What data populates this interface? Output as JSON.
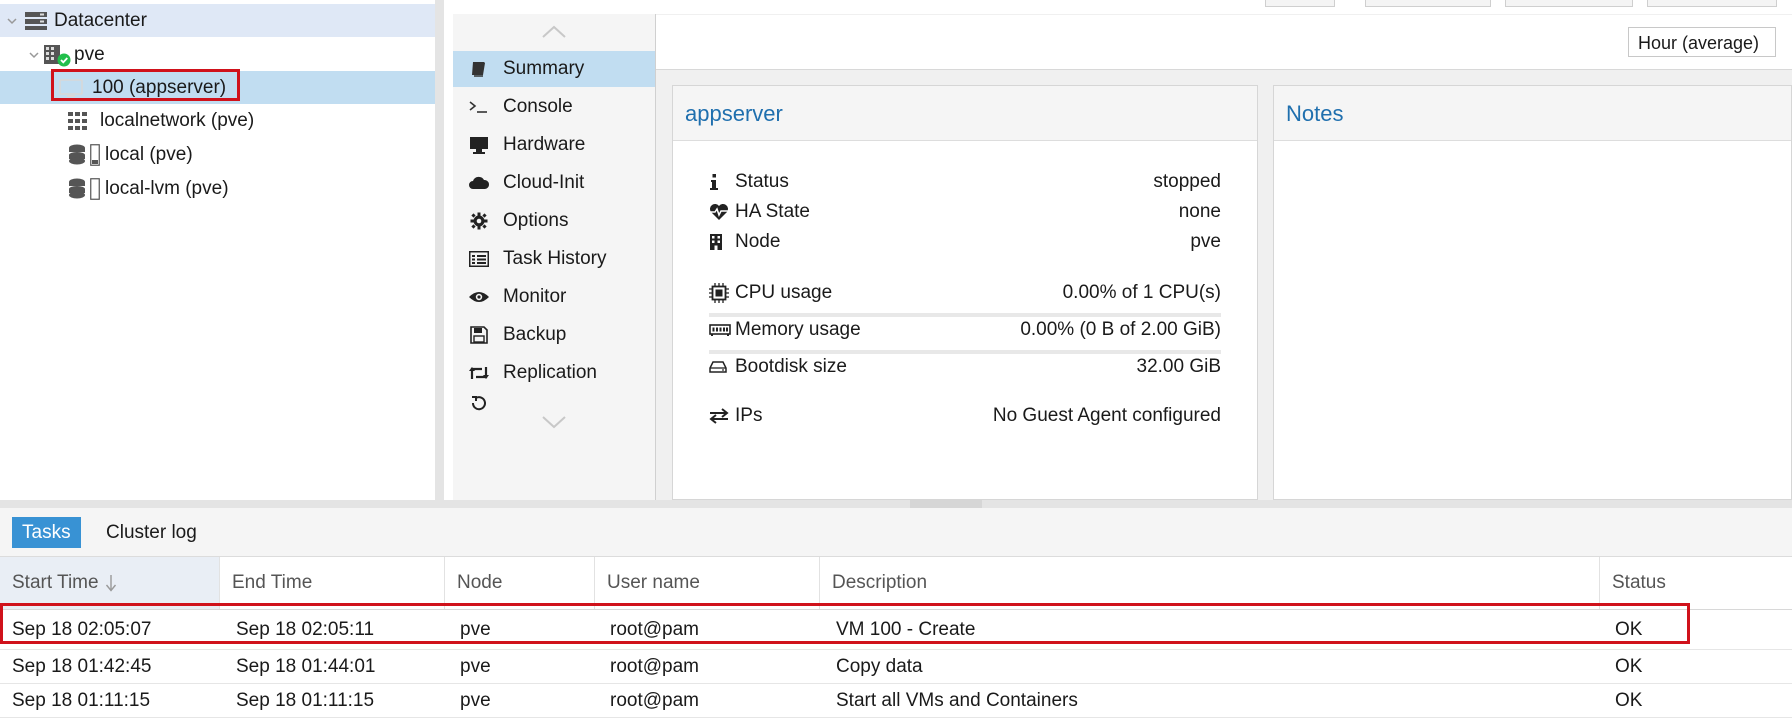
{
  "tree": {
    "datacenter": "Datacenter",
    "node": "pve",
    "vm": "100 (appserver)",
    "network": "localnetwork (pve)",
    "storage_local": "local (pve)",
    "storage_lvm": "local-lvm (pve)"
  },
  "menu": {
    "items": [
      {
        "label": "Summary",
        "icon": "book-icon"
      },
      {
        "label": "Console",
        "icon": "terminal-icon"
      },
      {
        "label": "Hardware",
        "icon": "desktop-icon"
      },
      {
        "label": "Cloud-Init",
        "icon": "cloud-icon"
      },
      {
        "label": "Options",
        "icon": "gear-icon"
      },
      {
        "label": "Task History",
        "icon": "list-icon"
      },
      {
        "label": "Monitor",
        "icon": "eye-icon"
      },
      {
        "label": "Backup",
        "icon": "floppy-icon"
      },
      {
        "label": "Replication",
        "icon": "retweet-icon"
      }
    ],
    "active": "Summary"
  },
  "toolbar": {
    "timeframe": "Hour (average)"
  },
  "summary": {
    "title": "appserver",
    "status_label": "Status",
    "status_value": "stopped",
    "ha_label": "HA State",
    "ha_value": "none",
    "node_label": "Node",
    "node_value": "pve",
    "cpu_label": "CPU usage",
    "cpu_value": "0.00% of 1 CPU(s)",
    "cpu_fraction": 0.0,
    "mem_label": "Memory usage",
    "mem_value": "0.00% (0 B of 2.00 GiB)",
    "mem_fraction": 0.0,
    "disk_label": "Bootdisk size",
    "disk_value": "32.00 GiB",
    "ips_label": "IPs",
    "ips_value": "No Guest Agent configured"
  },
  "notes": {
    "title": "Notes"
  },
  "log": {
    "tabs": [
      "Tasks",
      "Cluster log"
    ],
    "active_tab": "Tasks",
    "columns": [
      "Start Time",
      "End Time",
      "Node",
      "User name",
      "Description",
      "Status"
    ],
    "sort_column": "Start Time",
    "sort_direction": "descending",
    "rows": [
      {
        "start": "Sep 18 02:05:07",
        "end": "Sep 18 02:05:11",
        "node": "pve",
        "user": "root@pam",
        "desc": "VM 100 - Create",
        "status": "OK"
      },
      {
        "start": "Sep 18 01:42:45",
        "end": "Sep 18 01:44:01",
        "node": "pve",
        "user": "root@pam",
        "desc": "Copy data",
        "status": "OK"
      },
      {
        "start": "Sep 18 01:11:15",
        "end": "Sep 18 01:11:15",
        "node": "pve",
        "user": "root@pam",
        "desc": "Start all VMs and Containers",
        "status": "OK"
      }
    ]
  },
  "colors": {
    "accent": "#3892d4",
    "selection": "#c1ddf1",
    "highlight_box": "#d0121b",
    "title_blue": "#1f6fae",
    "running_green": "#21bf4b"
  }
}
